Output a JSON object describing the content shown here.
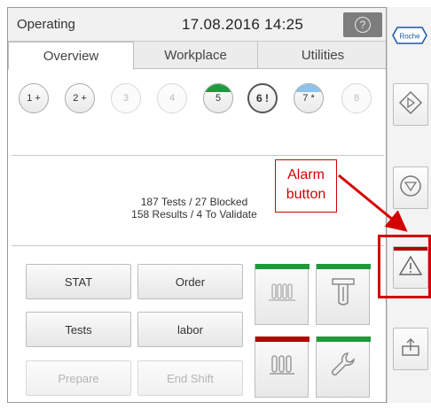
{
  "header": {
    "status": "Operating",
    "datetime": "17.08.2016 14:25",
    "help_glyph": "?"
  },
  "tabs": [
    {
      "label": "Overview",
      "active": true
    },
    {
      "label": "Workplace",
      "active": false
    },
    {
      "label": "Utilities",
      "active": false
    }
  ],
  "modules": [
    {
      "label": "1 +",
      "state": "normal",
      "cap": ""
    },
    {
      "label": "2 +",
      "state": "normal",
      "cap": ""
    },
    {
      "label": "3",
      "state": "dim",
      "cap": ""
    },
    {
      "label": "4",
      "state": "dim",
      "cap": ""
    },
    {
      "label": "5",
      "state": "normal",
      "cap": "#1f9a3a"
    },
    {
      "label": "6 !",
      "state": "strong",
      "cap": ""
    },
    {
      "label": "7 *",
      "state": "normal",
      "cap": "#8ec2ea"
    },
    {
      "label": "8",
      "state": "dim",
      "cap": ""
    }
  ],
  "summary": {
    "line1": "187 Tests / 27 Blocked",
    "line2": "158 Results / 4 To Validate"
  },
  "actions": {
    "stat": "STAT",
    "order": "Order",
    "tests": "Tests",
    "labor": "labor",
    "prepare": "Prepare",
    "end_shift": "End Shift"
  },
  "tiles": [
    {
      "icon": "rack-icon",
      "bar": "#1f9a3a"
    },
    {
      "icon": "probe-icon",
      "bar": "#1f9a3a"
    },
    {
      "icon": "reagent-rack-icon",
      "bar": "#b40000"
    },
    {
      "icon": "wrench-icon",
      "bar": "#1f9a3a"
    }
  ],
  "sidebar": {
    "logo_text": "Roche",
    "buttons": [
      {
        "icon": "diamond-start-icon"
      },
      {
        "icon": "stop-icon"
      },
      {
        "icon": "alarm-icon",
        "bar": "#b40000"
      },
      {
        "icon": "export-icon"
      }
    ]
  },
  "annotation": {
    "line1": "Alarm",
    "line2": "button",
    "color": "#d40000"
  }
}
